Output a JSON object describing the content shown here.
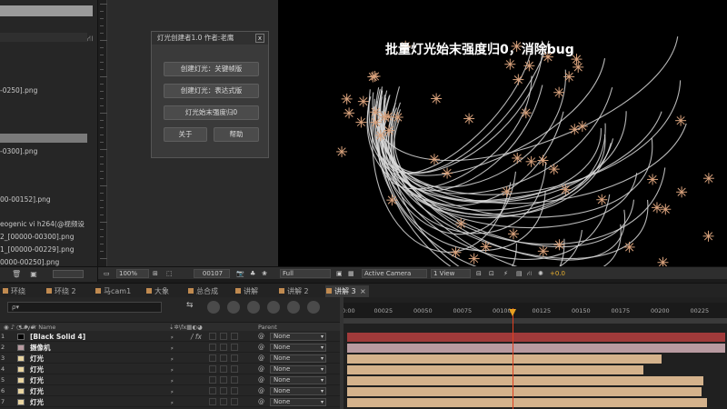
{
  "project": {
    "files": [
      "-0250].png",
      "-0300].png",
      "00-00152].png",
      "eogenic vi h264(@视频设",
      "2_[00000-00300].png",
      "1_[00000-00229].png",
      "0000-00250].png"
    ]
  },
  "dialog": {
    "title": "灯光创建者1.0 作者:老鹰",
    "close": "x",
    "buttons": [
      "创建灯光：关键帧版",
      "创建灯光：表达式版",
      "灯光始末强度归0"
    ],
    "about": "关于",
    "help": "帮助"
  },
  "viewer": {
    "caption": "批量灯光始末强度归0，消除bug"
  },
  "viewer_toolbar": {
    "zoom": "100%",
    "timecode": "00107",
    "resolution": "Full",
    "camera": "Active Camera",
    "views": "1 View",
    "exposure": "+0.0"
  },
  "tabs": [
    {
      "label": "环绕",
      "color": "#c08a50",
      "active": false
    },
    {
      "label": "环绕 2",
      "color": "#c08a50",
      "active": false
    },
    {
      "label": "马cam1",
      "color": "#c08a50",
      "active": false
    },
    {
      "label": "大象",
      "color": "#c08a50",
      "active": false
    },
    {
      "label": "总合成",
      "color": "#c08a50",
      "active": false
    },
    {
      "label": "讲解",
      "color": "#c08a50",
      "active": false
    },
    {
      "label": "讲解 2",
      "color": "#c08a50",
      "active": false
    },
    {
      "label": "讲解 3",
      "color": "#c08a50",
      "active": true
    }
  ],
  "timeline": {
    "search_placeholder": "ρ▾",
    "col_layer_name": "Layer Name",
    "col_switches": "⇣✲\\fx▦◐◕",
    "col_parent": "Parent",
    "ruler": [
      "0:00",
      "00025",
      "00050",
      "00075",
      "00100",
      "00125",
      "00150",
      "00175",
      "00200",
      "00225"
    ],
    "current_frame": 107,
    "layers": [
      {
        "num": "1",
        "name": "[Black Solid 4]",
        "parent": "None",
        "bar_color": "#a03a3a",
        "bar_end": 420,
        "swatch": "#000000"
      },
      {
        "num": "2",
        "name": "摄像机",
        "parent": "None",
        "bar_color": "#b89aa0",
        "bar_end": 420,
        "swatch": "#b89aa0"
      },
      {
        "num": "3",
        "name": "灯光",
        "parent": "None",
        "bar_color": "#d4b28c",
        "bar_end": 350,
        "swatch": "#e8d4a0"
      },
      {
        "num": "4",
        "name": "灯光",
        "parent": "None",
        "bar_color": "#d4b28c",
        "bar_end": 330,
        "swatch": "#e8d4a0"
      },
      {
        "num": "5",
        "name": "灯光",
        "parent": "None",
        "bar_color": "#d4b28c",
        "bar_end": 396,
        "swatch": "#e8d4a0"
      },
      {
        "num": "6",
        "name": "灯光",
        "parent": "None",
        "bar_color": "#d4b28c",
        "bar_end": 394,
        "swatch": "#e8d4a0"
      },
      {
        "num": "7",
        "name": "灯光",
        "parent": "None",
        "bar_color": "#d4b28c",
        "bar_end": 400,
        "swatch": "#e8d4a0"
      }
    ]
  }
}
